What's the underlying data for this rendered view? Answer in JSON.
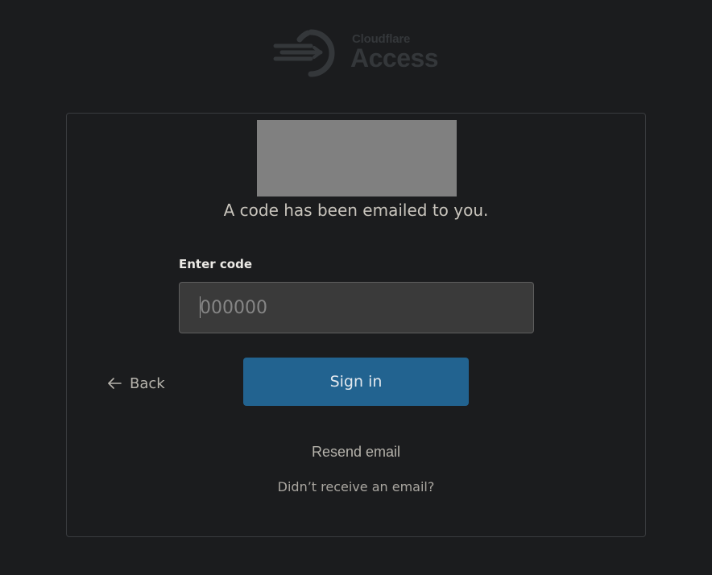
{
  "header": {
    "brand": "Cloudflare",
    "product": "Access",
    "logo_icon": "cloudflare-access-logo-icon"
  },
  "card": {
    "heading": "A code has been emailed to you.",
    "code_field": {
      "label": "Enter code",
      "placeholder": "000000",
      "value": ""
    },
    "back": {
      "icon": "arrow-left-icon",
      "label": "Back"
    },
    "signin_label": "Sign in",
    "resend_label": "Resend email",
    "help_label": "Didn’t receive an email?"
  },
  "colors": {
    "background": "#1b1c1e",
    "card_border": "#3a3c3f",
    "button": "#226390",
    "input_bg": "#3a3a3a",
    "logo": "#34373a"
  }
}
